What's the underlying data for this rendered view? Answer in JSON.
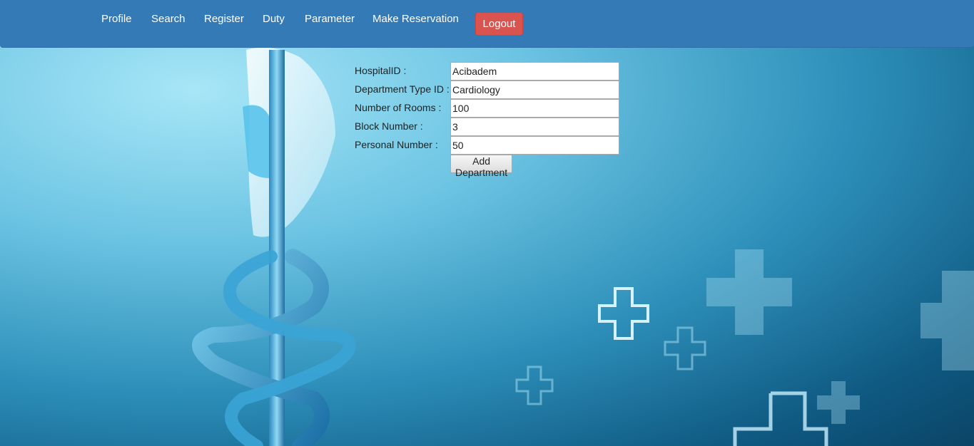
{
  "nav": {
    "items": [
      {
        "label": "Profile"
      },
      {
        "label": "Search"
      },
      {
        "label": "Register"
      },
      {
        "label": "Duty"
      },
      {
        "label": "Parameter"
      },
      {
        "label": "Make Reservation"
      }
    ],
    "logout_label": "Logout"
  },
  "form": {
    "fields": [
      {
        "label": "HospitalID :",
        "value": "Acibadem"
      },
      {
        "label": "Department Type ID :",
        "value": "Cardiology"
      },
      {
        "label": "Number of Rooms :",
        "value": "100"
      },
      {
        "label": "Block Number :",
        "value": "3"
      },
      {
        "label": "Personal Number :",
        "value": "50"
      }
    ],
    "submit_label": "Add Department"
  },
  "colors": {
    "navbar": "#337ab7",
    "logout": "#d9534f"
  }
}
